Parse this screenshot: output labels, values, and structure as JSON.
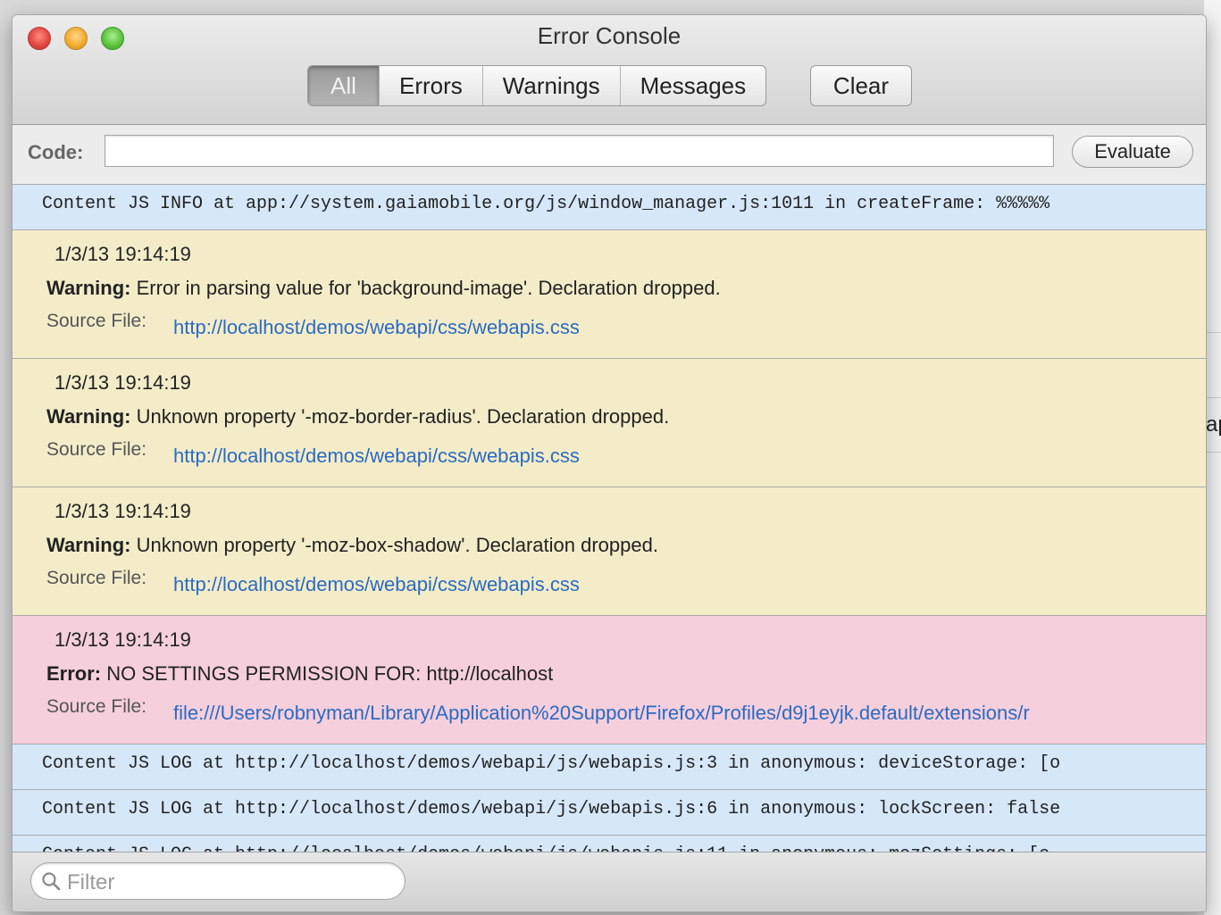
{
  "window": {
    "title": "Error Console"
  },
  "filter_tabs": [
    {
      "label": "All",
      "selected": true
    },
    {
      "label": "Errors",
      "selected": false
    },
    {
      "label": "Warnings",
      "selected": false
    },
    {
      "label": "Messages",
      "selected": false
    }
  ],
  "toolbar": {
    "clear_label": "Clear"
  },
  "code_bar": {
    "label": "Code:",
    "value": "",
    "evaluate_label": "Evaluate"
  },
  "entries": {
    "info1": {
      "text": "Content JS INFO at app://system.gaiamobile.org/js/window_manager.js:1011 in createFrame: %%%%%"
    },
    "warn1": {
      "timestamp": "1/3/13 19:14:19",
      "kind": "Warning:",
      "message": " Error in parsing value for 'background-image'.  Declaration dropped.",
      "source_label": "Source File:",
      "source_url": "http://localhost/demos/webapi/css/webapis.css"
    },
    "warn2": {
      "timestamp": "1/3/13 19:14:19",
      "kind": "Warning:",
      "message": " Unknown property '-moz-border-radius'.  Declaration dropped.",
      "source_label": "Source File:",
      "source_url": "http://localhost/demos/webapi/css/webapis.css"
    },
    "warn3": {
      "timestamp": "1/3/13 19:14:19",
      "kind": "Warning:",
      "message": " Unknown property '-moz-box-shadow'.  Declaration dropped.",
      "source_label": "Source File:",
      "source_url": "http://localhost/demos/webapi/css/webapis.css"
    },
    "err1": {
      "timestamp": "1/3/13 19:14:19",
      "kind": "Error:",
      "message": " NO SETTINGS PERMISSION FOR: http://localhost",
      "source_label": "Source File:",
      "source_url": "file:///Users/robnyman/Library/Application%20Support/Firefox/Profiles/d9j1eyjk.default/extensions/r"
    },
    "log1": {
      "text": "Content JS LOG at http://localhost/demos/webapi/js/webapis.js:3 in anonymous: deviceStorage: [o"
    },
    "log2": {
      "text": "Content JS LOG at http://localhost/demos/webapi/js/webapis.js:6 in anonymous: lockScreen: false"
    },
    "log3": {
      "text": "Content JS LOG at http://localhost/demos/webapi/js/webapis.js:11 in anonymous: mozSettings: [o"
    }
  },
  "footer": {
    "filter_placeholder": "Filter"
  },
  "background_app": {
    "text": "ap"
  },
  "colors": {
    "info_row": "#d6e7f8",
    "warning_row": "#f4ecc9",
    "error_row": "#f5cfdc",
    "link": "#2a6bc2"
  },
  "icons": [
    "close-button",
    "minimize-button",
    "zoom-button",
    "search-icon"
  ]
}
